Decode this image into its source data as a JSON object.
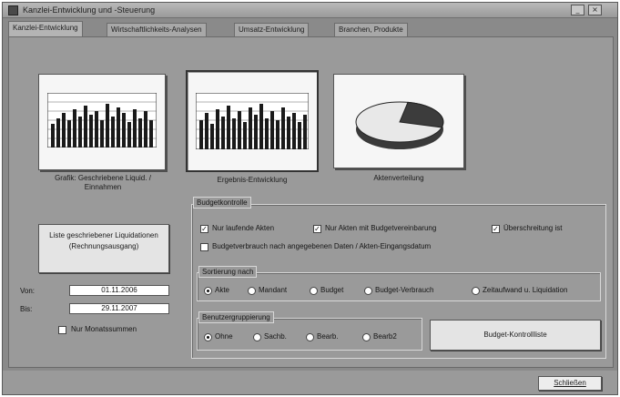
{
  "window": {
    "title": "Kanzlei-Entwicklung und -Steuerung",
    "minimize_label": "_",
    "close_label": "×"
  },
  "tabs": [
    {
      "label": "Kanzlei-Entwicklung",
      "active": true
    },
    {
      "label": "Wirtschaftlichkeits-Analysen",
      "active": false
    },
    {
      "label": "Umsatz-Entwicklung",
      "active": false
    },
    {
      "label": "Branchen, Produkte",
      "active": false
    }
  ],
  "charts": [
    {
      "caption": "Grafik: Geschriebene Liquid. / Einnahmen",
      "icon": "bar-chart-icon",
      "pressed": false
    },
    {
      "caption": "Ergebnis-Entwicklung",
      "icon": "bar-chart-icon",
      "pressed": true
    },
    {
      "caption": "Aktenverteilung",
      "icon": "pie-chart-icon",
      "pressed": false
    }
  ],
  "liquidations": {
    "button_label": "Liste geschriebener Liquidationen (Rechnungsausgang)",
    "from_label": "Von:",
    "from_value": "01.11.2006",
    "to_label": "Bis:",
    "to_value": "29.11.2007",
    "monthly_checkbox_label": "Nur Monatssummen",
    "monthly_checked": false
  },
  "budget": {
    "group_title": "Budgetkontrolle",
    "options": [
      {
        "label": "Nur laufende Akten",
        "checked": true
      },
      {
        "label": "Nur Akten mit Budgetvereinbarung",
        "checked": true
      },
      {
        "label": "Überschreitung ist",
        "checked": true
      }
    ],
    "consumption_label": "Budgetverbrauch nach angegebenen Daten / Akten-Eingangsdatum",
    "consumption_checked": false,
    "sort": {
      "title": "Sortierung nach",
      "options": [
        {
          "label": "Akte",
          "selected": true
        },
        {
          "label": "Mandant",
          "selected": false
        },
        {
          "label": "Budget",
          "selected": false
        },
        {
          "label": "Budget-Verbrauch",
          "selected": false
        },
        {
          "label": "Zeitaufwand u. Liquidation",
          "selected": false
        }
      ]
    },
    "grouping": {
      "title": "Benutzergruppierung",
      "options": [
        {
          "label": "Ohne",
          "selected": true
        },
        {
          "label": "Sachb.",
          "selected": false
        },
        {
          "label": "Bearb.",
          "selected": false
        },
        {
          "label": "Bearb2",
          "selected": false
        }
      ]
    },
    "control_button_label": "Budget-Kontrollliste"
  },
  "footer": {
    "close_button_label": "Schließen"
  }
}
